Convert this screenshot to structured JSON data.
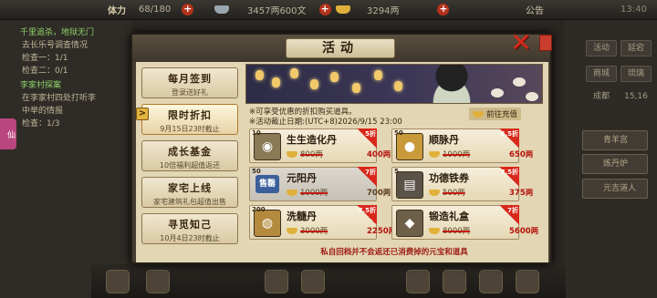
{
  "topbar": {
    "stamina_label": "体力",
    "stamina_value": "68/180",
    "silver_value": "3457两600文",
    "ingot_value": "3294两",
    "notice_label": "公告",
    "clock": "13:40"
  },
  "quests": [
    {
      "title": "千里追杀，地狱无门",
      "lines": [
        "去长乐号调查情况",
        "检查一：1/1",
        "检查二：0/1"
      ]
    },
    {
      "title": "李家村探案",
      "lines": [
        "在李家村四处打听李",
        "中举的情报",
        "检查：1/3"
      ]
    }
  ],
  "left_tab": "仙",
  "right_panel": {
    "buttons": [
      "活动",
      "延宕",
      "商城",
      "琉璃",
      "成都",
      "15,16"
    ],
    "long_buttons": [
      "青羊宫",
      "炼丹炉",
      "元吉道人"
    ]
  },
  "modal": {
    "title": "活动",
    "goto_recharge": "前往充值",
    "notes": [
      "※可享受优惠的折扣购买道具。",
      "※活动截止日期:(UTC+8)2026/9/15 23:00"
    ],
    "footer": "私自回档并不会返还已消费掉的元宝和道具",
    "menu": [
      {
        "title": "每月签到",
        "sub": "登录送好礼"
      },
      {
        "title": "限时折扣",
        "sub": "9月15日23时截止"
      },
      {
        "title": "成长基金",
        "sub": "10倍福利超值返还"
      },
      {
        "title": "家宅上线",
        "sub": "家宅建筑礼包超值出售"
      },
      {
        "title": "寻觅知己",
        "sub": "10月4日23时截止"
      }
    ],
    "items": [
      {
        "name": "生生造化丹",
        "qty": "10",
        "orig": "800两",
        "now": "400两",
        "discount": "5折"
      },
      {
        "name": "顺脉丹",
        "qty": "50",
        "orig": "1000两",
        "now": "650两",
        "discount": "6.5折"
      },
      {
        "name": "元阳丹",
        "qty": "50",
        "orig": "1000两",
        "now": "700两",
        "discount": "7折",
        "sold": "售罄"
      },
      {
        "name": "功德铁券",
        "qty": "5",
        "orig": "500两",
        "now": "375两",
        "discount": "7.5折"
      },
      {
        "name": "洗髓丹",
        "qty": "200",
        "orig": "3000两",
        "now": "2250两",
        "discount": "7.5折"
      },
      {
        "name": "锻造礼盒",
        "qty": "",
        "orig": "8000两",
        "now": "5600两",
        "discount": "7折"
      }
    ]
  }
}
